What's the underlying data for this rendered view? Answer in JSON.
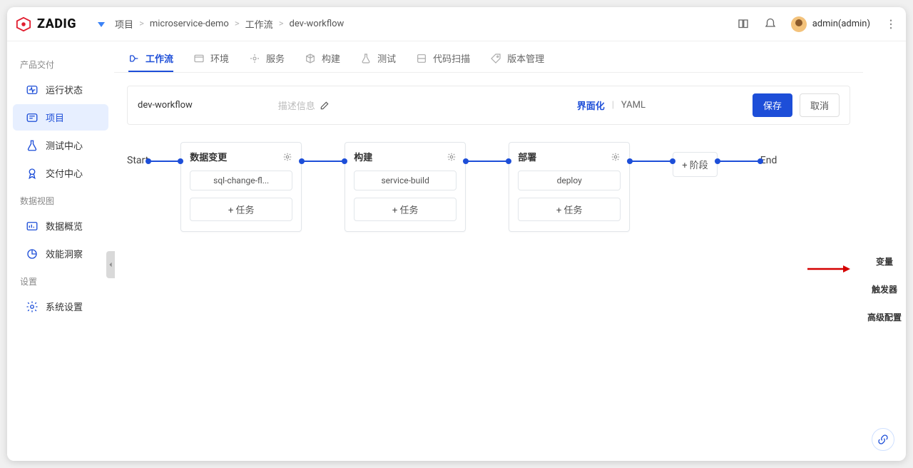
{
  "logo_text": "ZADIG",
  "breadcrumb": {
    "b1": "项目",
    "b2": "microservice-demo",
    "b3": "工作流",
    "b4": "dev-workflow"
  },
  "user_label": "admin(admin)",
  "sidebar": {
    "sec1": "产品交付",
    "items1": {
      "0": "运行状态",
      "1": "项目",
      "2": "测试中心",
      "3": "交付中心"
    },
    "sec2": "数据视图",
    "items2": {
      "0": "数据概览",
      "1": "效能洞察"
    },
    "sec3": "设置",
    "items3": {
      "0": "系统设置"
    }
  },
  "tabs": {
    "0": "工作流",
    "1": "环境",
    "2": "服务",
    "3": "构建",
    "4": "测试",
    "5": "代码扫描",
    "6": "版本管理"
  },
  "editor": {
    "name": "dev-workflow",
    "desc_placeholder": "描述信息",
    "format_ui": "界面化",
    "format_yaml": "YAML",
    "save": "保存",
    "cancel": "取消"
  },
  "flow": {
    "start": "Start",
    "end": "End",
    "add_stage": "+ 阶段",
    "add_task": "+ 任务",
    "stages": [
      {
        "title": "数据变更",
        "task": "sql-change-fl..."
      },
      {
        "title": "构建",
        "task": "service-build"
      },
      {
        "title": "部署",
        "task": "deploy"
      }
    ]
  },
  "rail": {
    "0": "变量",
    "1": "触发器",
    "2": "高级配置"
  }
}
